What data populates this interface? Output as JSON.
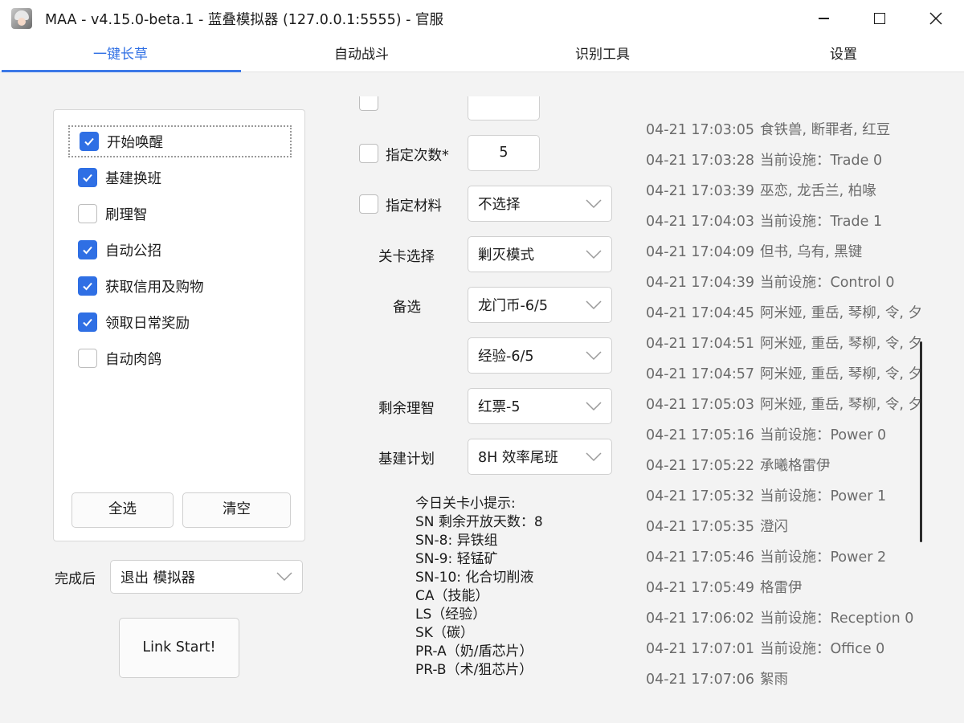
{
  "window": {
    "title": "MAA - v4.15.0-beta.1 - 蓝叠模拟器 (127.0.0.1:5555) - 官服"
  },
  "tabs": [
    {
      "label": "一键长草",
      "active": true
    },
    {
      "label": "自动战斗",
      "active": false
    },
    {
      "label": "识别工具",
      "active": false
    },
    {
      "label": "设置",
      "active": false
    }
  ],
  "tasks": [
    {
      "label": "开始唤醒",
      "checked": true
    },
    {
      "label": "基建换班",
      "checked": true
    },
    {
      "label": "刷理智",
      "checked": false
    },
    {
      "label": "自动公招",
      "checked": true
    },
    {
      "label": "获取信用及购物",
      "checked": true
    },
    {
      "label": "领取日常奖励",
      "checked": true
    },
    {
      "label": "自动肉鸽",
      "checked": false
    }
  ],
  "task_buttons": {
    "select_all": "全选",
    "clear": "清空"
  },
  "after_complete": {
    "label": "完成后",
    "value": "退出 模拟器"
  },
  "link_start": "Link Start!",
  "settings": {
    "specify_times": {
      "label": "指定次数*",
      "checked": false,
      "value": "5"
    },
    "specify_material": {
      "label": "指定材料",
      "checked": false,
      "value": "不选择"
    },
    "stage_select": {
      "label": "关卡选择",
      "value": "剿灭模式"
    },
    "alternate": {
      "label": "备选",
      "values": [
        "龙门币-6/5",
        "经验-6/5"
      ]
    },
    "remaining_sanity": {
      "label": "剩余理智",
      "value": "红票-5"
    },
    "infrast_plan": {
      "label": "基建计划",
      "value": "8H 效率尾班"
    }
  },
  "tips": {
    "title": "今日关卡小提示:",
    "lines": [
      "SN 剩余开放天数：8",
      "SN-8: 异铁组",
      "SN-9: 轻锰矿",
      "SN-10: 化合切削液",
      "CA（技能）",
      "LS（经验）",
      "SK（碳）",
      "PR-A（奶/盾芯片）",
      "PR-B（术/狙芯片）"
    ]
  },
  "log": [
    {
      "time": "04-21  17:03:05",
      "msg": "食铁兽, 断罪者, 红豆"
    },
    {
      "time": "04-21  17:03:28",
      "msg": "当前设施：Trade 0"
    },
    {
      "time": "04-21  17:03:39",
      "msg": "巫恋, 龙舌兰, 柏喙"
    },
    {
      "time": "04-21  17:04:03",
      "msg": "当前设施：Trade 1"
    },
    {
      "time": "04-21  17:04:09",
      "msg": "但书, 乌有, 黑键"
    },
    {
      "time": "04-21  17:04:39",
      "msg": "当前设施：Control 0"
    },
    {
      "time": "04-21  17:04:45",
      "msg": "阿米娅, 重岳, 琴柳, 令, 夕"
    },
    {
      "time": "04-21  17:04:51",
      "msg": "阿米娅, 重岳, 琴柳, 令, 夕"
    },
    {
      "time": "04-21  17:04:57",
      "msg": "阿米娅, 重岳, 琴柳, 令, 夕"
    },
    {
      "time": "04-21  17:05:03",
      "msg": "阿米娅, 重岳, 琴柳, 令, 夕"
    },
    {
      "time": "04-21  17:05:16",
      "msg": "当前设施：Power 0"
    },
    {
      "time": "04-21  17:05:22",
      "msg": "承曦格雷伊"
    },
    {
      "time": "04-21  17:05:32",
      "msg": "当前设施：Power 1"
    },
    {
      "time": "04-21  17:05:35",
      "msg": "澄闪"
    },
    {
      "time": "04-21  17:05:46",
      "msg": "当前设施：Power 2"
    },
    {
      "time": "04-21  17:05:49",
      "msg": "格雷伊"
    },
    {
      "time": "04-21  17:06:02",
      "msg": "当前设施：Reception 0"
    },
    {
      "time": "04-21  17:07:01",
      "msg": "当前设施：Office 0"
    },
    {
      "time": "04-21  17:07:06",
      "msg": "絮雨"
    }
  ],
  "colors": {
    "accent": "#2f6fe4",
    "background": "#f3f3f3"
  }
}
